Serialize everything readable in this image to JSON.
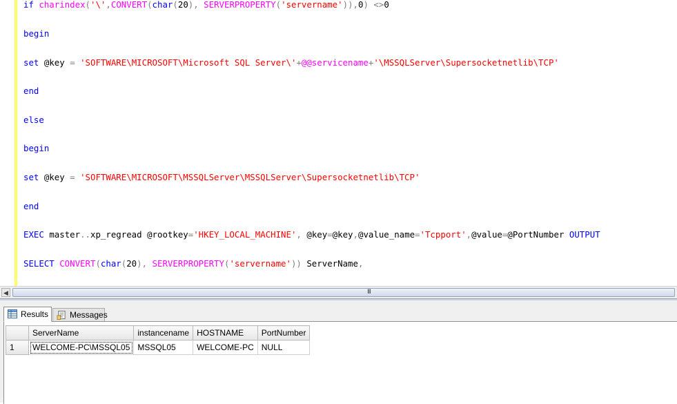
{
  "editor": {
    "lines": [
      [
        {
          "t": "if ",
          "c": "kw"
        },
        {
          "t": "charindex",
          "c": "fn"
        },
        {
          "t": "(",
          "c": "op"
        },
        {
          "t": "'\\'",
          "c": "str"
        },
        {
          "t": ",",
          "c": "op"
        },
        {
          "t": "CONVERT",
          "c": "fn"
        },
        {
          "t": "(",
          "c": "op"
        },
        {
          "t": "char",
          "c": "kw"
        },
        {
          "t": "(",
          "c": "op"
        },
        {
          "t": "20",
          "c": "pl"
        },
        {
          "t": "),",
          "c": "op"
        },
        {
          "t": " ",
          "c": "pl"
        },
        {
          "t": "SERVERPROPERTY",
          "c": "fn"
        },
        {
          "t": "(",
          "c": "op"
        },
        {
          "t": "'servername'",
          "c": "str"
        },
        {
          "t": ")),",
          "c": "op"
        },
        {
          "t": "0",
          "c": "pl"
        },
        {
          "t": ")",
          "c": "op"
        },
        {
          "t": " ",
          "c": "pl"
        },
        {
          "t": "<>",
          "c": "op"
        },
        {
          "t": "0",
          "c": "pl"
        }
      ],
      [
        {
          "t": "begin",
          "c": "kw"
        }
      ],
      [
        {
          "t": "set ",
          "c": "kw"
        },
        {
          "t": "@key ",
          "c": "pl"
        },
        {
          "t": "=",
          "c": "op"
        },
        {
          "t": " ",
          "c": "pl"
        },
        {
          "t": "'SOFTWARE\\MICROSOFT\\Microsoft SQL Server\\'",
          "c": "str"
        },
        {
          "t": "+",
          "c": "op"
        },
        {
          "t": "@@servicename",
          "c": "gv"
        },
        {
          "t": "+",
          "c": "op"
        },
        {
          "t": "'\\MSSQLServer\\Supersocketnetlib\\TCP'",
          "c": "str"
        }
      ],
      [
        {
          "t": "end",
          "c": "kw"
        }
      ],
      [
        {
          "t": "else",
          "c": "kw"
        }
      ],
      [
        {
          "t": "begin",
          "c": "kw"
        }
      ],
      [
        {
          "t": "set ",
          "c": "kw"
        },
        {
          "t": "@key ",
          "c": "pl"
        },
        {
          "t": "=",
          "c": "op"
        },
        {
          "t": " ",
          "c": "pl"
        },
        {
          "t": "'SOFTWARE\\MICROSOFT\\MSSQLServer\\MSSQLServer\\Supersocketnetlib\\TCP'",
          "c": "str"
        }
      ],
      [
        {
          "t": "end",
          "c": "kw"
        }
      ],
      [
        {
          "t": "EXEC ",
          "c": "kw"
        },
        {
          "t": "master",
          "c": "pl"
        },
        {
          "t": "..",
          "c": "op"
        },
        {
          "t": "xp_regread ",
          "c": "pl"
        },
        {
          "t": "@rootkey",
          "c": "pl"
        },
        {
          "t": "=",
          "c": "op"
        },
        {
          "t": "'HKEY_LOCAL_MACHINE'",
          "c": "str"
        },
        {
          "t": ",",
          "c": "op"
        },
        {
          "t": " ",
          "c": "pl"
        },
        {
          "t": "@key",
          "c": "pl"
        },
        {
          "t": "=",
          "c": "op"
        },
        {
          "t": "@key",
          "c": "pl"
        },
        {
          "t": ",",
          "c": "op"
        },
        {
          "t": "@value_name",
          "c": "pl"
        },
        {
          "t": "=",
          "c": "op"
        },
        {
          "t": "'Tcpport'",
          "c": "str"
        },
        {
          "t": ",",
          "c": "op"
        },
        {
          "t": "@value",
          "c": "pl"
        },
        {
          "t": "=",
          "c": "op"
        },
        {
          "t": "@PortNumber ",
          "c": "pl"
        },
        {
          "t": "OUTPUT",
          "c": "kw"
        }
      ],
      [
        {
          "t": "SELECT ",
          "c": "kw"
        },
        {
          "t": "CONVERT",
          "c": "fn"
        },
        {
          "t": "(",
          "c": "op"
        },
        {
          "t": "char",
          "c": "kw"
        },
        {
          "t": "(",
          "c": "op"
        },
        {
          "t": "20",
          "c": "pl"
        },
        {
          "t": "),",
          "c": "op"
        },
        {
          "t": " ",
          "c": "pl"
        },
        {
          "t": "SERVERPROPERTY",
          "c": "fn"
        },
        {
          "t": "(",
          "c": "op"
        },
        {
          "t": "'servername'",
          "c": "str"
        },
        {
          "t": "))",
          "c": "op"
        },
        {
          "t": " ServerName",
          "c": "pl"
        },
        {
          "t": ",",
          "c": "op"
        }
      ]
    ]
  },
  "scrollbar": {
    "grip": "III"
  },
  "results": {
    "tabs": {
      "results_label": "Results",
      "messages_label": "Messages"
    },
    "columns": [
      "ServerName",
      "instancename",
      "HOSTNAME",
      "PortNumber"
    ],
    "rows": [
      {
        "num": "1",
        "cells": [
          "WELCOME-PC\\MSSQL05",
          "MSSQL05",
          "WELCOME-PC",
          "NULL"
        ]
      }
    ]
  },
  "colors": {
    "keyword": "#0000ff",
    "function": "#ff00ff",
    "string": "#ff0000",
    "operator": "#808080",
    "change_bar": "#ffff66"
  }
}
